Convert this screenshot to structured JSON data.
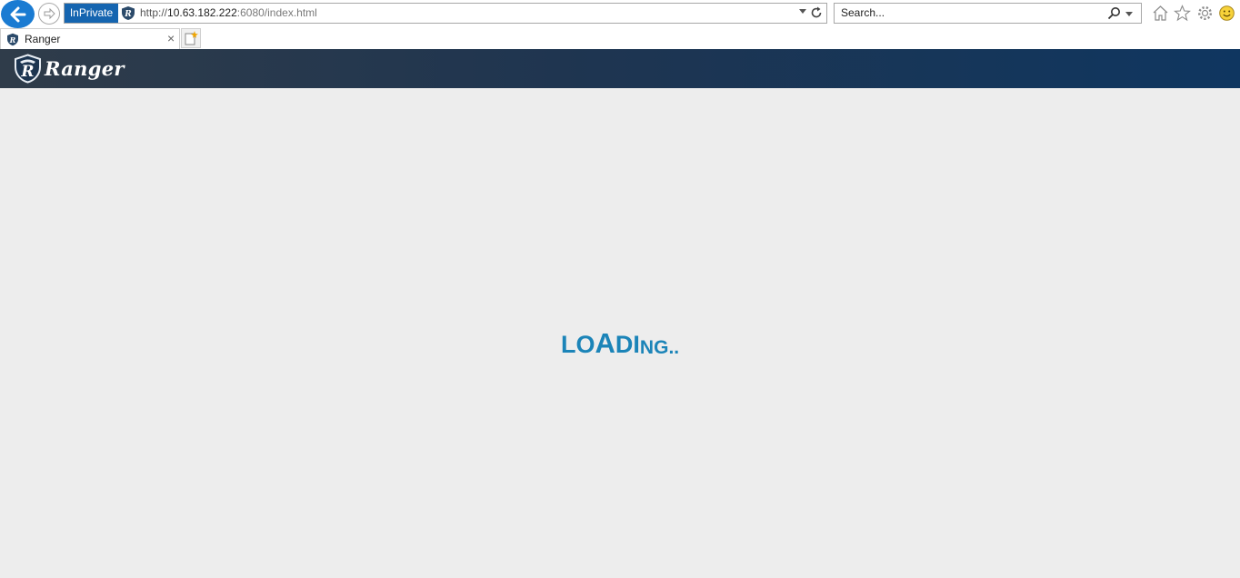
{
  "browser": {
    "inprivate_label": "InPrivate",
    "url_scheme": "http://",
    "url_host": "10.63.182.222",
    "url_path": ":6080/index.html",
    "search_placeholder": "Search...",
    "tab_title": "Ranger",
    "tab_close": "×",
    "icons": [
      "back-arrow-icon",
      "forward-arrow-icon",
      "site-shield-icon",
      "refresh-icon",
      "search-icon",
      "home-icon",
      "favorites-star-icon",
      "settings-gear-icon",
      "feedback-smiley-icon",
      "new-tab-icon"
    ]
  },
  "app": {
    "logo_text": "Ranger",
    "logo_letter": "R",
    "header_gradient": [
      "#2f3c4a",
      "#0f3660"
    ]
  },
  "content": {
    "loading_letters": [
      "L",
      "O",
      "A",
      "D",
      "I",
      "N",
      "G",
      ".",
      "."
    ],
    "loading_color": "#1b84b8"
  }
}
